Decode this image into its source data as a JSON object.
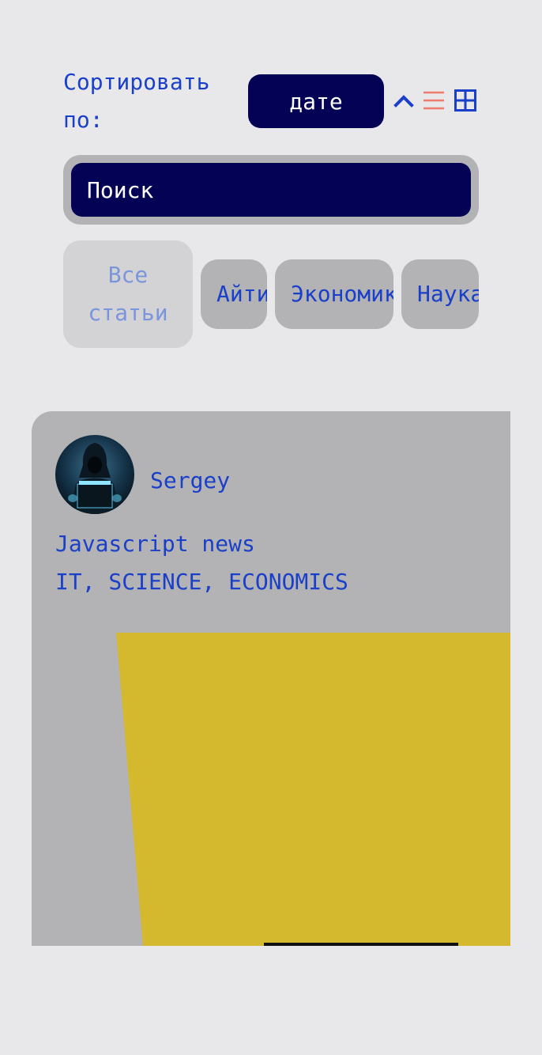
{
  "sort": {
    "label": "Сортировать по:",
    "selected": "дате"
  },
  "icons": {
    "order": "chevron-up-icon",
    "list_view": "list-icon",
    "grid_view": "grid-icon"
  },
  "colors": {
    "accent_dark": "#040255",
    "text_blue": "#1a3fc8",
    "list_icon": "#ee7a6e",
    "card_bg": "#b3b3b5",
    "image_yellow": "#d4b82e",
    "page_bg": "#e8e8ea"
  },
  "search": {
    "placeholder": "Поиск"
  },
  "categories": [
    {
      "label": "Все статьи",
      "active": true
    },
    {
      "label": "Айти",
      "active": false
    },
    {
      "label": "Экономика",
      "active": false
    },
    {
      "label": "Наука",
      "active": false
    }
  ],
  "article": {
    "author": "Sergey",
    "title": "Javascript news",
    "tags": "IT, SCIENCE, ECONOMICS"
  }
}
